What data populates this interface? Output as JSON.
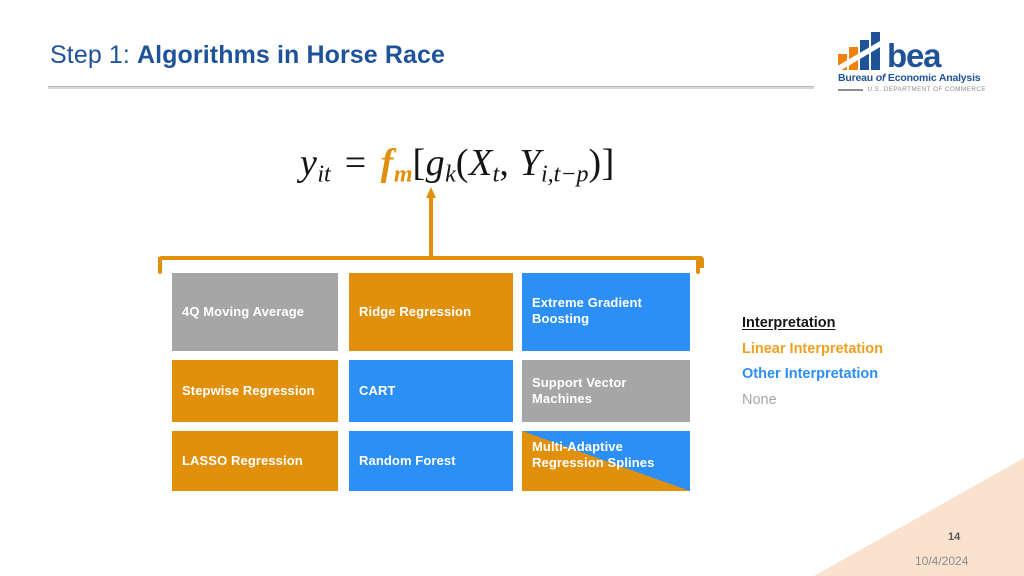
{
  "slide": {
    "title_prefix": "Step 1: ",
    "title_main": "Algorithms in Horse Race",
    "slide_number": "14",
    "date": "10/4/2024"
  },
  "logo": {
    "wordmark": "bea",
    "subtitle_1": "Bureau ",
    "subtitle_2": "of",
    "subtitle_3": " Economic Analysis",
    "department": "U.S. DEPARTMENT OF COMMERCE"
  },
  "formula": {
    "lhs_var": "y",
    "lhs_sub": "it",
    "equals": "=",
    "fn_var": "f",
    "fn_sub": "m",
    "open_bracket": "[",
    "inner_var": "g",
    "inner_sub": "k",
    "open_paren": "(",
    "arg1_var": "X",
    "arg1_sub": "t",
    "comma": ", ",
    "arg2_var": "Y",
    "arg2_sub": "i,t−p",
    "close_paren": ")",
    "close_bracket": "]"
  },
  "grid": {
    "rows": [
      [
        {
          "label": "4Q Moving Average",
          "color": "gray"
        },
        {
          "label": "Ridge Regression",
          "color": "orange"
        },
        {
          "label": "Extreme Gradient Boosting",
          "color": "blue"
        }
      ],
      [
        {
          "label": "Stepwise Regression",
          "color": "orange"
        },
        {
          "label": "CART",
          "color": "blue"
        },
        {
          "label": "Support Vector Machines",
          "color": "gray"
        }
      ],
      [
        {
          "label": "LASSO Regression",
          "color": "orange"
        },
        {
          "label": "Random Forest",
          "color": "blue"
        },
        {
          "label": "Multi-Adaptive Regression Splines",
          "color": "split"
        }
      ]
    ]
  },
  "legend": {
    "title": "Interpretation",
    "linear": "Linear Interpretation",
    "other": "Other Interpretation",
    "none": "None"
  },
  "colors": {
    "orange": "#e0900a",
    "blue": "#2b8ff5",
    "gray": "#a6a6a6",
    "title_blue": "#1f5399",
    "corner_peach": "#fae0cb"
  }
}
